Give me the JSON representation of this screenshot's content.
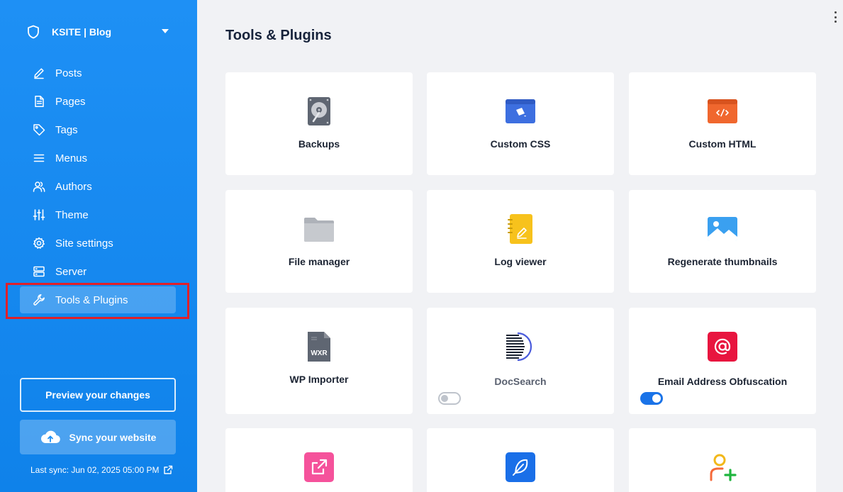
{
  "sidebar": {
    "site_name": "KSITE | Blog",
    "items": [
      {
        "label": "Posts",
        "icon": "pen-icon"
      },
      {
        "label": "Pages",
        "icon": "document-icon"
      },
      {
        "label": "Tags",
        "icon": "tag-icon"
      },
      {
        "label": "Menus",
        "icon": "menu-icon"
      },
      {
        "label": "Authors",
        "icon": "users-icon"
      },
      {
        "label": "Theme",
        "icon": "sliders-icon"
      },
      {
        "label": "Site settings",
        "icon": "gear-icon"
      },
      {
        "label": "Server",
        "icon": "server-icon"
      },
      {
        "label": "Tools & Plugins",
        "icon": "wrench-icon",
        "active": true
      }
    ],
    "preview_label": "Preview your changes",
    "sync_label": "Sync your website",
    "last_sync": "Last sync: Jun 02, 2025 05:00 PM"
  },
  "main": {
    "title": "Tools & Plugins",
    "tools": [
      {
        "label": "Backups",
        "icon": "hard-drive-icon"
      },
      {
        "label": "Custom CSS",
        "icon": "css-window-icon"
      },
      {
        "label": "Custom HTML",
        "icon": "html-code-icon"
      },
      {
        "label": "File manager",
        "icon": "folder-icon"
      },
      {
        "label": "Log viewer",
        "icon": "notebook-icon"
      },
      {
        "label": "Regenerate thumbnails",
        "icon": "image-icon"
      },
      {
        "label": "WP Importer",
        "icon": "wxr-file-icon",
        "badge": "WXR"
      },
      {
        "label": "DocSearch",
        "icon": "docsearch-icon",
        "enabled": false
      },
      {
        "label": "Email Address Obfuscation",
        "icon": "at-sign-icon",
        "enabled": true
      },
      {
        "label": "",
        "icon": "external-link-icon"
      },
      {
        "label": "",
        "icon": "feather-icon"
      },
      {
        "label": "",
        "icon": "add-user-icon"
      }
    ]
  },
  "colors": {
    "sidebar": "#1e90f5",
    "accent": "#1a73e8",
    "highlight_border": "#e0202a",
    "css_icon": "#3d6fe0",
    "html_icon": "#f0672e",
    "log_icon": "#f7c21c",
    "image_icon": "#3aa0f0",
    "email_icon": "#e8153f",
    "link_icon": "#f5529b",
    "feather_icon": "#1a6fe8",
    "user_icon": "#f2b81a"
  }
}
